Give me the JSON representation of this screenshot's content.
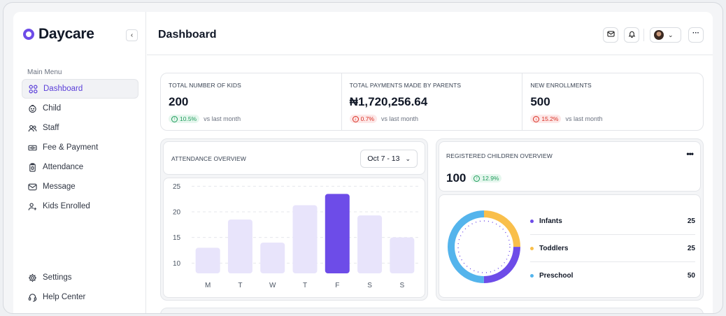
{
  "brand": {
    "name": "Daycare",
    "accent": "#6d4ce8"
  },
  "sidebar": {
    "caption": "Main Menu",
    "items": [
      {
        "label": "Dashboard",
        "icon": "grid-icon",
        "active": true
      },
      {
        "label": "Child",
        "icon": "child-face-icon"
      },
      {
        "label": "Staff",
        "icon": "users-icon"
      },
      {
        "label": "Fee & Payment",
        "icon": "money-icon"
      },
      {
        "label": "Attendance",
        "icon": "clipboard-icon"
      },
      {
        "label": "Message",
        "icon": "mail-icon"
      },
      {
        "label": "Kids Enrolled",
        "icon": "user-plus-icon"
      }
    ],
    "bottom_items": [
      {
        "label": "Settings",
        "icon": "gear-icon"
      },
      {
        "label": "Help Center",
        "icon": "headset-icon"
      }
    ]
  },
  "header": {
    "title": "Dashboard"
  },
  "stats": [
    {
      "label": "TOTAL NUMBER OF KIDS",
      "value": "200",
      "change": "10.5%",
      "direction": "up",
      "note": "vs last month"
    },
    {
      "label": "TOTAL PAYMENTS MADE BY PARENTS",
      "value": "₦1,720,256.64",
      "change": "0.7%",
      "direction": "down",
      "note": "vs last month"
    },
    {
      "label": "NEW ENROLLMENTS",
      "value": "500",
      "change": "15.2%",
      "direction": "down",
      "note": "vs last month"
    }
  ],
  "attendance": {
    "title": "ATTENDANCE OVERVIEW",
    "range_label": "Oct 7 - 13"
  },
  "registered": {
    "title": "REGISTERED CHILDREN OVERVIEW",
    "total": "100",
    "change": "12.9%",
    "legend": [
      {
        "label": "Infants",
        "value": "25",
        "color": "#6d4ce8"
      },
      {
        "label": "Toddlers",
        "value": "25",
        "color": "#f9bf4b"
      },
      {
        "label": "Preschool",
        "value": "50",
        "color": "#54b4ec"
      }
    ]
  },
  "chart_data": {
    "type": "bar",
    "categories": [
      "M",
      "T",
      "W",
      "T",
      "F",
      "S",
      "S"
    ],
    "values": [
      13,
      18.5,
      14,
      21.3,
      23.5,
      19.3,
      15
    ],
    "highlight_index": 4,
    "y_ticks": [
      "25",
      "20",
      "15",
      "10"
    ],
    "ylim": [
      8,
      26
    ],
    "colors": {
      "bar": "#e8e4fb",
      "highlight": "#6d4ce8"
    }
  }
}
